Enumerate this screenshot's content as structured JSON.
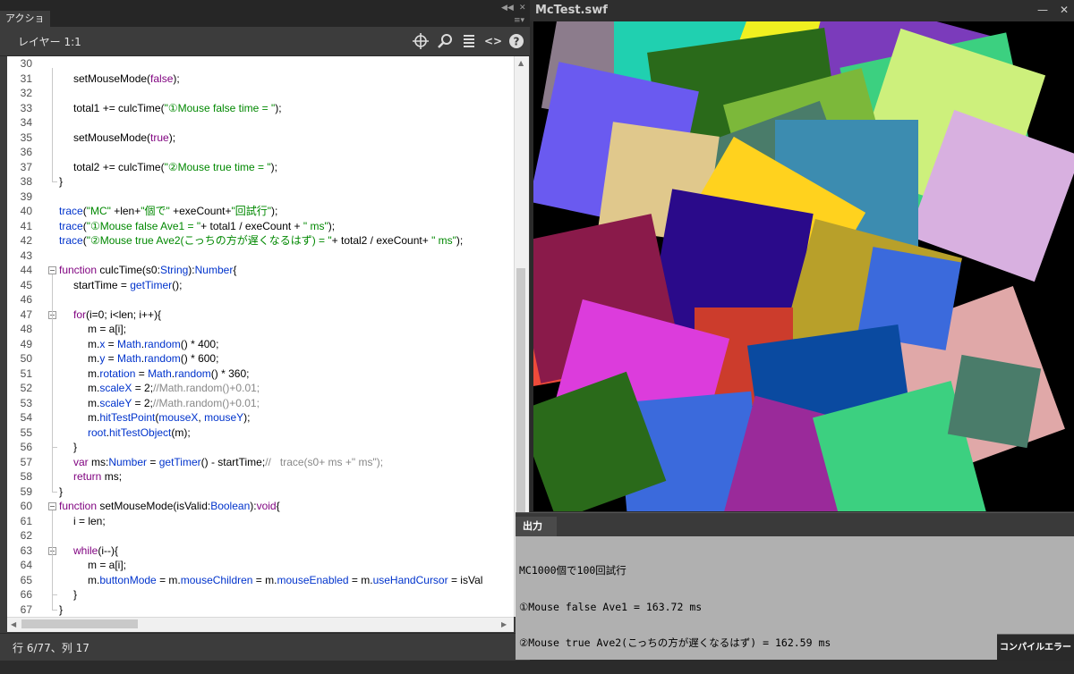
{
  "actions_panel": {
    "tab_title": "アクション",
    "layer_label": "レイヤー 1:1",
    "toolbar_icons": [
      "target-icon",
      "search-icon",
      "list-icon",
      "code-brackets-icon",
      "help-icon"
    ],
    "status": "行 6/77、列 17",
    "code_lines": [
      {
        "n": "30",
        "indent": 0,
        "tokens": []
      },
      {
        "n": "31",
        "indent": 1,
        "tokens": [
          [
            "setMouseMode(",
            "pl"
          ],
          [
            "false",
            "kw"
          ],
          [
            ");",
            "pl"
          ]
        ]
      },
      {
        "n": "32",
        "indent": 0,
        "tokens": []
      },
      {
        "n": "33",
        "indent": 1,
        "tokens": [
          [
            "total1 += culcTime(",
            "pl"
          ],
          [
            "\"①Mouse false time = \"",
            "str"
          ],
          [
            ");",
            "pl"
          ]
        ]
      },
      {
        "n": "34",
        "indent": 0,
        "tokens": []
      },
      {
        "n": "35",
        "indent": 1,
        "tokens": [
          [
            "setMouseMode(",
            "pl"
          ],
          [
            "true",
            "kw"
          ],
          [
            ");",
            "pl"
          ]
        ]
      },
      {
        "n": "36",
        "indent": 0,
        "tokens": []
      },
      {
        "n": "37",
        "indent": 1,
        "tokens": [
          [
            "total2 += culcTime(",
            "pl"
          ],
          [
            "\"②Mouse true time = \"",
            "str"
          ],
          [
            ");",
            "pl"
          ]
        ]
      },
      {
        "n": "38",
        "indent": 0,
        "tokens": [
          [
            "}",
            "pl"
          ]
        ]
      },
      {
        "n": "39",
        "indent": 0,
        "tokens": []
      },
      {
        "n": "40",
        "indent": 0,
        "tokens": [
          [
            "trace",
            "fn"
          ],
          [
            "(",
            "pl"
          ],
          [
            "\"MC\"",
            "str"
          ],
          [
            " +len+",
            "pl"
          ],
          [
            "\"個で\"",
            "str"
          ],
          [
            " +exeCount+",
            "pl"
          ],
          [
            "\"回試行\"",
            "str"
          ],
          [
            ");",
            "pl"
          ]
        ]
      },
      {
        "n": "41",
        "indent": 0,
        "tokens": [
          [
            "trace",
            "fn"
          ],
          [
            "(",
            "pl"
          ],
          [
            "\"①Mouse false Ave1 = \"",
            "str"
          ],
          [
            "+ total1 / exeCount + ",
            "pl"
          ],
          [
            "\" ms\"",
            "str"
          ],
          [
            ");",
            "pl"
          ]
        ]
      },
      {
        "n": "42",
        "indent": 0,
        "tokens": [
          [
            "trace",
            "fn"
          ],
          [
            "(",
            "pl"
          ],
          [
            "\"②Mouse true Ave2(こっちの方が遅くなるはず) = \"",
            "str"
          ],
          [
            "+ total2 / exeCount+ ",
            "pl"
          ],
          [
            "\" ms\"",
            "str"
          ],
          [
            ");",
            "pl"
          ]
        ]
      },
      {
        "n": "43",
        "indent": 0,
        "tokens": []
      },
      {
        "n": "44",
        "indent": 0,
        "tokens": [
          [
            "function",
            "kw"
          ],
          [
            " culcTime(s0:",
            "pl"
          ],
          [
            "String",
            "fn"
          ],
          [
            "):",
            "pl"
          ],
          [
            "Number",
            "fn"
          ],
          [
            "{",
            "pl"
          ]
        ]
      },
      {
        "n": "45",
        "indent": 1,
        "tokens": [
          [
            "startTime = ",
            "pl"
          ],
          [
            "getTimer",
            "fn"
          ],
          [
            "();",
            "pl"
          ]
        ]
      },
      {
        "n": "46",
        "indent": 0,
        "tokens": []
      },
      {
        "n": "47",
        "indent": 1,
        "tokens": [
          [
            "for",
            "kw"
          ],
          [
            "(i=0; i<len; i++){",
            "pl"
          ]
        ]
      },
      {
        "n": "48",
        "indent": 2,
        "tokens": [
          [
            "m = a[i];",
            "pl"
          ]
        ]
      },
      {
        "n": "49",
        "indent": 2,
        "tokens": [
          [
            "m.",
            "pl"
          ],
          [
            "x",
            "fn"
          ],
          [
            " = ",
            "pl"
          ],
          [
            "Math",
            "fn"
          ],
          [
            ".",
            "pl"
          ],
          [
            "random",
            "fn"
          ],
          [
            "() * 400;",
            "pl"
          ]
        ]
      },
      {
        "n": "50",
        "indent": 2,
        "tokens": [
          [
            "m.",
            "pl"
          ],
          [
            "y",
            "fn"
          ],
          [
            " = ",
            "pl"
          ],
          [
            "Math",
            "fn"
          ],
          [
            ".",
            "pl"
          ],
          [
            "random",
            "fn"
          ],
          [
            "() * 600;",
            "pl"
          ]
        ]
      },
      {
        "n": "51",
        "indent": 2,
        "tokens": [
          [
            "m.",
            "pl"
          ],
          [
            "rotation",
            "fn"
          ],
          [
            " = ",
            "pl"
          ],
          [
            "Math",
            "fn"
          ],
          [
            ".",
            "pl"
          ],
          [
            "random",
            "fn"
          ],
          [
            "() * 360;",
            "pl"
          ]
        ]
      },
      {
        "n": "52",
        "indent": 2,
        "tokens": [
          [
            "m.",
            "pl"
          ],
          [
            "scaleX",
            "fn"
          ],
          [
            " = 2;",
            "pl"
          ],
          [
            "//Math.random()+0.01;",
            "cm"
          ]
        ]
      },
      {
        "n": "53",
        "indent": 2,
        "tokens": [
          [
            "m.",
            "pl"
          ],
          [
            "scaleY",
            "fn"
          ],
          [
            " = 2;",
            "pl"
          ],
          [
            "//Math.random()+0.01;",
            "cm"
          ]
        ]
      },
      {
        "n": "54",
        "indent": 2,
        "tokens": [
          [
            "m.",
            "pl"
          ],
          [
            "hitTestPoint",
            "fn"
          ],
          [
            "(",
            "pl"
          ],
          [
            "mouseX",
            "fn"
          ],
          [
            ", ",
            "pl"
          ],
          [
            "mouseY",
            "fn"
          ],
          [
            ");",
            "pl"
          ]
        ]
      },
      {
        "n": "55",
        "indent": 2,
        "tokens": [
          [
            "root",
            "fn"
          ],
          [
            ".",
            "pl"
          ],
          [
            "hitTestObject",
            "fn"
          ],
          [
            "(m);",
            "pl"
          ]
        ]
      },
      {
        "n": "56",
        "indent": 1,
        "tokens": [
          [
            "}",
            "pl"
          ]
        ]
      },
      {
        "n": "57",
        "indent": 1,
        "tokens": [
          [
            "var",
            "kw"
          ],
          [
            " ms:",
            "pl"
          ],
          [
            "Number",
            "fn"
          ],
          [
            " = ",
            "pl"
          ],
          [
            "getTimer",
            "fn"
          ],
          [
            "() - startTime;",
            "pl"
          ],
          [
            "//   trace(s0+ ms +\" ms\");",
            "cm"
          ]
        ]
      },
      {
        "n": "58",
        "indent": 1,
        "tokens": [
          [
            "return",
            "kw"
          ],
          [
            " ms;",
            "pl"
          ]
        ]
      },
      {
        "n": "59",
        "indent": 0,
        "tokens": [
          [
            "}",
            "pl"
          ]
        ]
      },
      {
        "n": "60",
        "indent": 0,
        "tokens": [
          [
            "function",
            "kw"
          ],
          [
            " setMouseMode(isValid:",
            "pl"
          ],
          [
            "Boolean",
            "fn"
          ],
          [
            "):",
            "pl"
          ],
          [
            "void",
            "kw"
          ],
          [
            "{",
            "pl"
          ]
        ]
      },
      {
        "n": "61",
        "indent": 1,
        "tokens": [
          [
            "i = len;",
            "pl"
          ]
        ]
      },
      {
        "n": "62",
        "indent": 0,
        "tokens": []
      },
      {
        "n": "63",
        "indent": 1,
        "tokens": [
          [
            "while",
            "kw"
          ],
          [
            "(i--){",
            "pl"
          ]
        ]
      },
      {
        "n": "64",
        "indent": 2,
        "tokens": [
          [
            "m = a[i];",
            "pl"
          ]
        ]
      },
      {
        "n": "65",
        "indent": 2,
        "tokens": [
          [
            "m.",
            "pl"
          ],
          [
            "buttonMode",
            "fn"
          ],
          [
            " = m.",
            "pl"
          ],
          [
            "mouseChildren",
            "fn"
          ],
          [
            " = m.",
            "pl"
          ],
          [
            "mouseEnabled",
            "fn"
          ],
          [
            " = m.",
            "pl"
          ],
          [
            "useHandCursor",
            "fn"
          ],
          [
            " = isVal",
            "pl"
          ]
        ]
      },
      {
        "n": "66",
        "indent": 1,
        "tokens": [
          [
            "}",
            "pl"
          ]
        ]
      },
      {
        "n": "67",
        "indent": 0,
        "tokens": [
          [
            "}",
            "pl"
          ]
        ]
      }
    ]
  },
  "swf_window": {
    "title": "McTest.swf",
    "min_button": "—",
    "close_button": "✕",
    "square_colors": [
      "#8c7c8c",
      "#20d0b0",
      "#6a5af0",
      "#7cb83a",
      "#cdf07c",
      "#7b3bbb",
      "#4a7c6a",
      "#e0c88c",
      "#3c8cb0",
      "#ffd21e",
      "#2a0a8a",
      "#b8a02a",
      "#8a1a4a",
      "#e0a8a8",
      "#dc3cdc",
      "#0a4aa0",
      "#3b6adc",
      "#2a6a1a",
      "#cc3c2c",
      "#9a2a9a",
      "#3cd080",
      "#f0f020",
      "#d8b0e0",
      "#ee4b3a"
    ]
  },
  "output_panel": {
    "tab_title": "出力",
    "lines": [
      "MC1000個で100回試行",
      "①Mouse false Ave1 = 163.72 ms",
      "②Mouse true Ave2(こっちの方が遅くなるはず) = 162.59 ms"
    ],
    "compile_tab": "コンパイルエラー"
  }
}
